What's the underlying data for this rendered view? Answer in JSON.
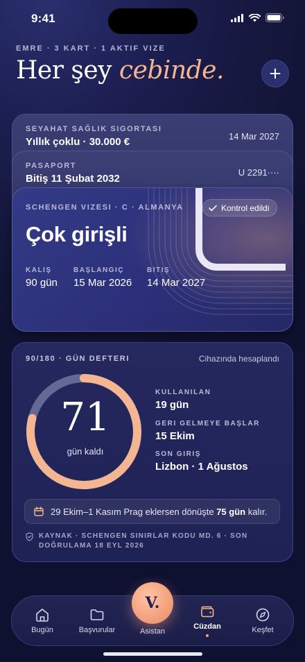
{
  "status": {
    "time": "9:41"
  },
  "header": {
    "eyebrow": "EMRE · 3 KART · 1 AKTIF VIZE",
    "title_plain": "Her şey",
    "title_accent": "cebinde."
  },
  "cards": {
    "insurance": {
      "label": "SEYAHAT SAĞLIK SIGORTASI",
      "value": "Yıllık çoklu · 30.000 €",
      "right": "14 Mar 2027"
    },
    "passport": {
      "label": "PASAPORT",
      "value": "Bitiş 11 Şubat 2032",
      "right": "U 2291····"
    },
    "visa": {
      "label": "SCHENGEN VIZESI · C · ALMANYA",
      "badge": "Kontrol edildi",
      "title": "Çok girişli",
      "stats": [
        {
          "label": "KALIŞ",
          "value": "90 gün"
        },
        {
          "label": "BAŞLANGIÇ",
          "value": "15 Mar 2026"
        },
        {
          "label": "BITIŞ",
          "value": "14 Mar 2027"
        }
      ]
    }
  },
  "ledger": {
    "title": "90/180 · GÜN DEFTERI",
    "note": "Cihazında hesaplandı",
    "days_left": "71",
    "days_left_caption": "gün kaldı",
    "progress_fraction": 0.79,
    "stats": [
      {
        "label": "KULLANILAN",
        "value": "19 gün"
      },
      {
        "label": "GERI GELMEYE BAŞLAR",
        "value": "15 Ekim"
      },
      {
        "label": "SON GIRIŞ",
        "value": "Lizbon · 1 Ağustos"
      }
    ],
    "tip_prefix": "29 Ekim–1 Kasım Prag eklersen dönüşte",
    "tip_bold": "75 gün",
    "tip_suffix": "kalır.",
    "source": "KAYNAK · SCHENGEN SINIRLAR KODU MD. 6 · SON DOĞRULAMA 18 EYL 2026"
  },
  "tabs": [
    {
      "label": "Bugün",
      "icon": "home-icon"
    },
    {
      "label": "Başvurular",
      "icon": "folder-icon"
    },
    {
      "label": "Asistan",
      "icon": "assistant-logo"
    },
    {
      "label": "Cüzdan",
      "icon": "wallet-icon"
    },
    {
      "label": "Keşfet",
      "icon": "compass-icon"
    }
  ],
  "fab_glyph": "V.",
  "colors": {
    "accent": "#f4b592",
    "ring_track": "#9aa0c4",
    "background": "#1b1d4e"
  }
}
